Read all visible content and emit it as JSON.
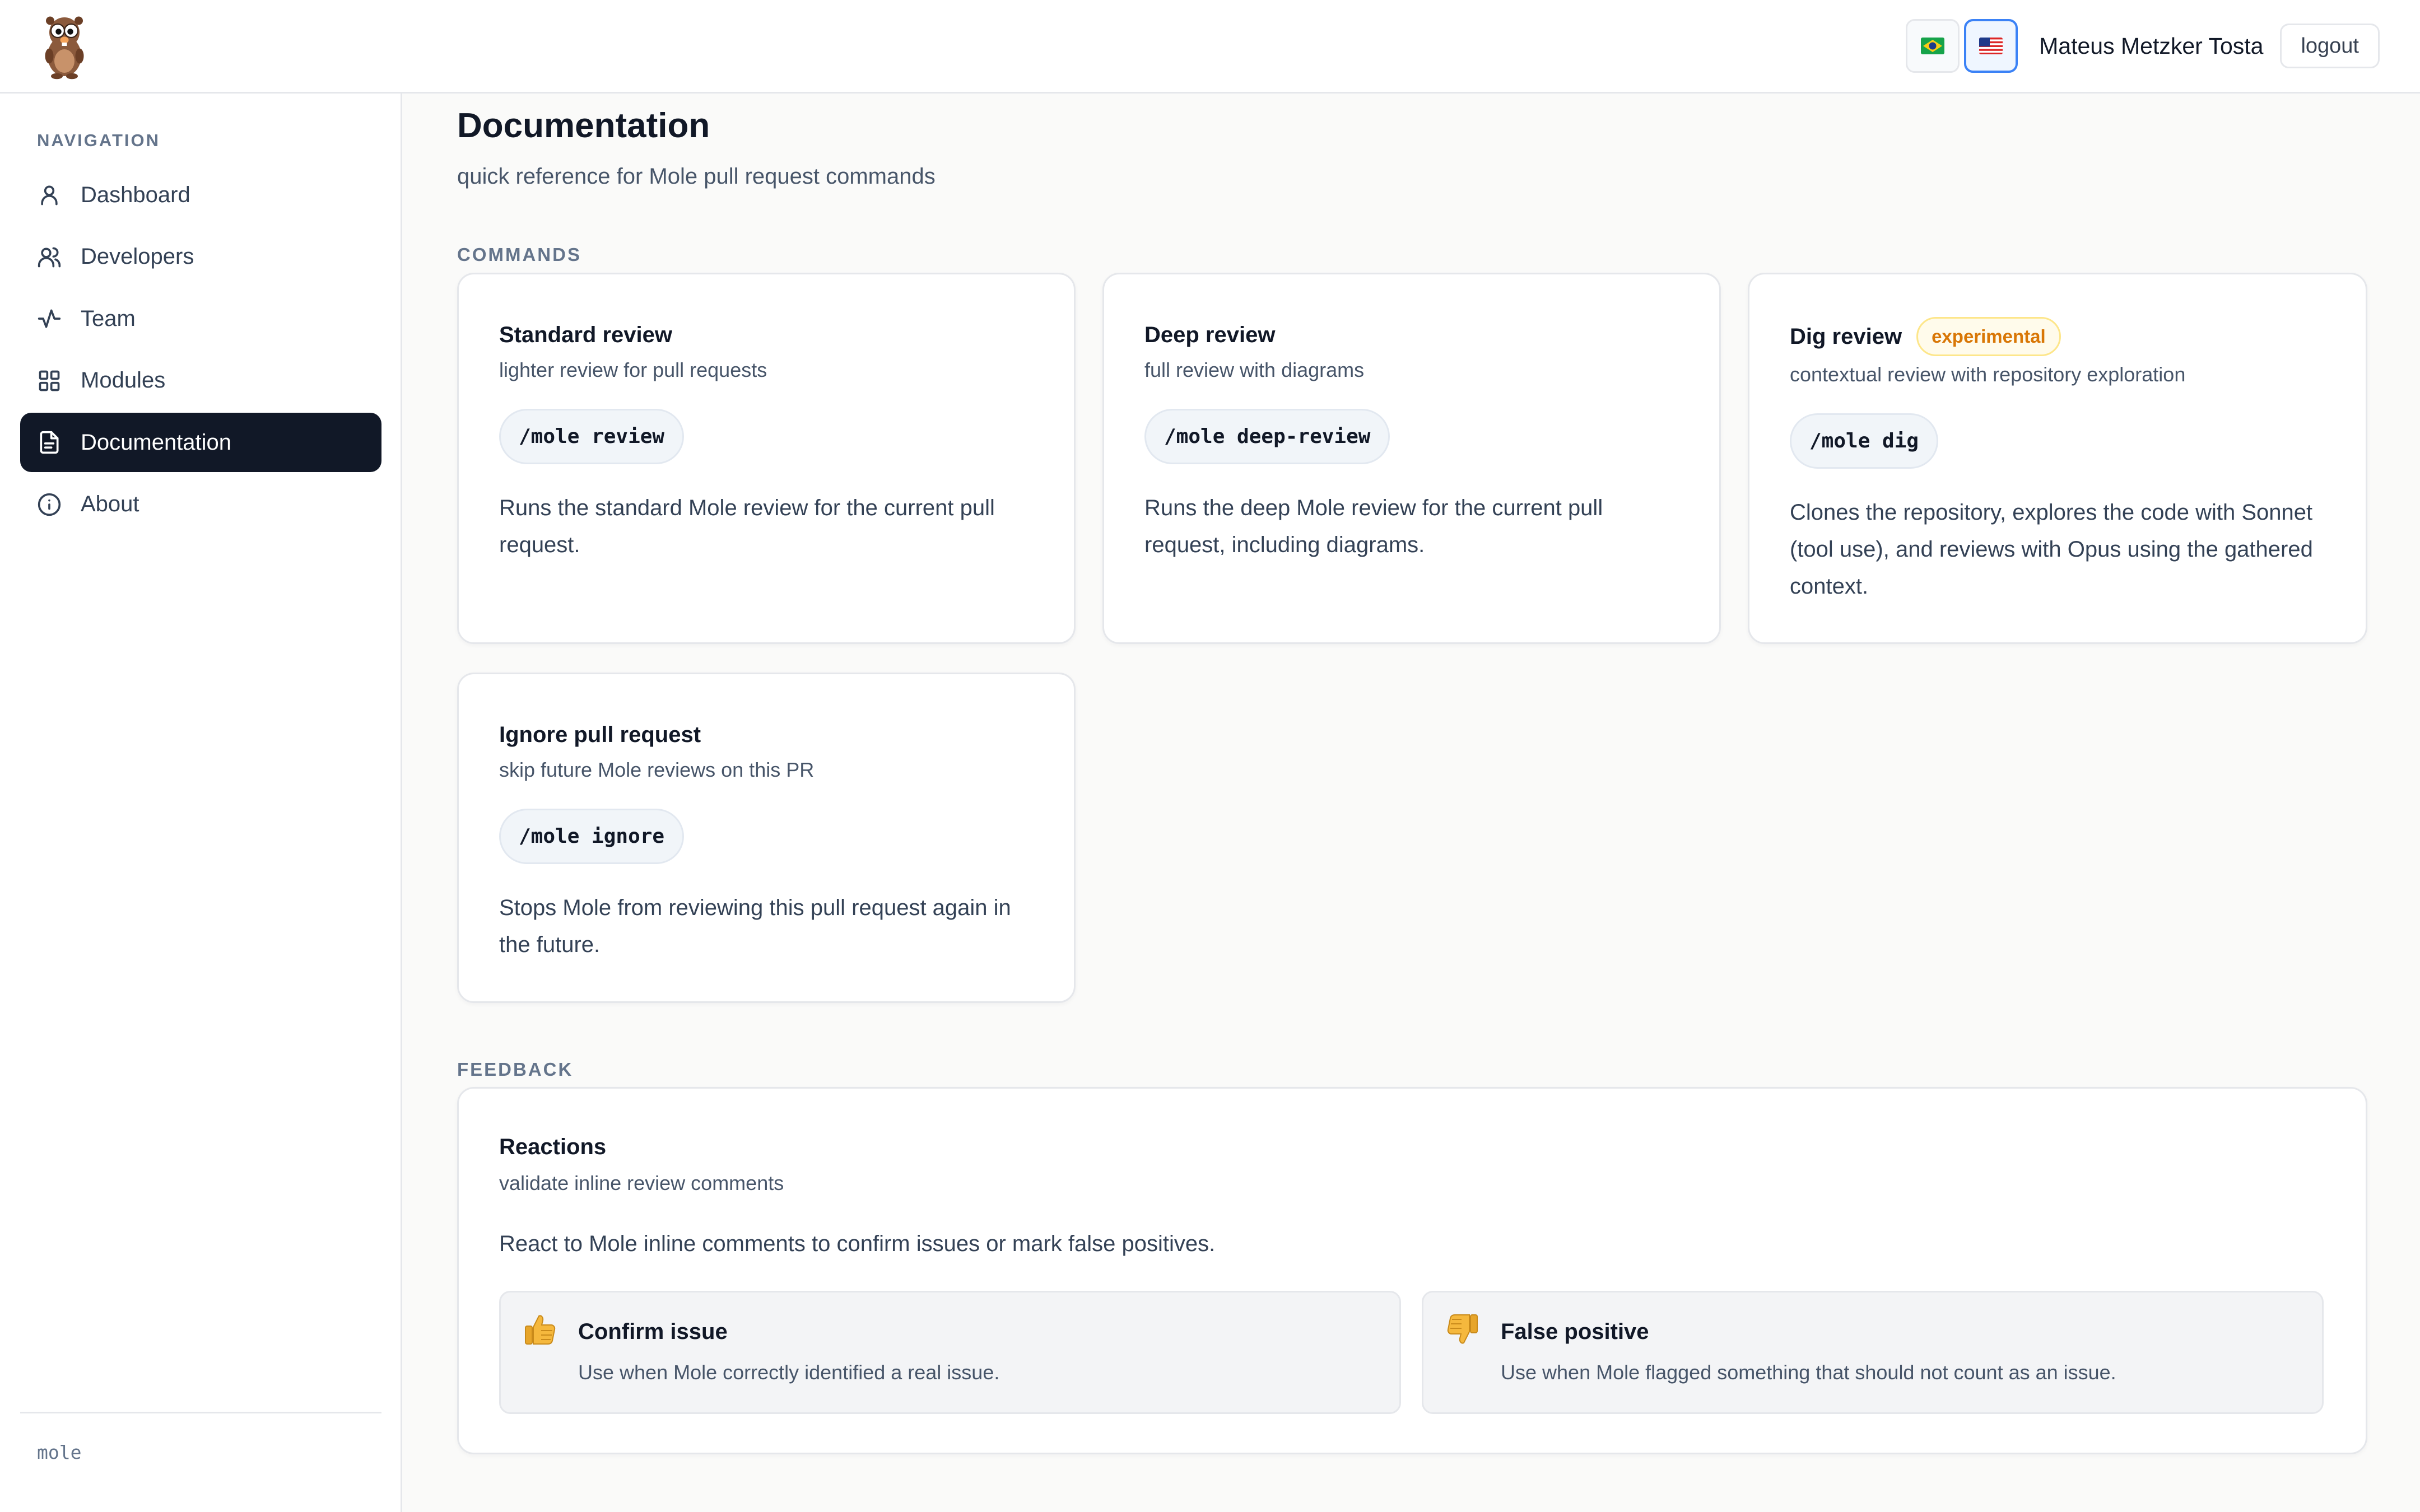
{
  "header": {
    "logo_name": "mole-logo",
    "flags": [
      {
        "name": "brazil-flag",
        "active": false
      },
      {
        "name": "usa-flag",
        "active": true
      }
    ],
    "user_name": "Mateus Metzker Tosta",
    "logout_label": "logout"
  },
  "sidebar": {
    "heading": "NAVIGATION",
    "items": [
      {
        "label": "Dashboard",
        "icon": "user-icon",
        "active": false
      },
      {
        "label": "Developers",
        "icon": "users-icon",
        "active": false
      },
      {
        "label": "Team",
        "icon": "activity-icon",
        "active": false
      },
      {
        "label": "Modules",
        "icon": "grid-icon",
        "active": false
      },
      {
        "label": "Documentation",
        "icon": "document-icon",
        "active": true
      },
      {
        "label": "About",
        "icon": "info-icon",
        "active": false
      }
    ],
    "footer": "mole"
  },
  "main": {
    "title": "Documentation",
    "subtitle": "quick reference for Mole pull request commands",
    "commands_label": "COMMANDS",
    "commands": [
      {
        "title": "Standard review",
        "subtitle": "lighter review for pull requests",
        "command": "/mole review",
        "description": "Runs the standard Mole review for the current pull request."
      },
      {
        "title": "Deep review",
        "subtitle": "full review with diagrams",
        "command": "/mole deep-review",
        "description": "Runs the deep Mole review for the current pull request, including diagrams."
      },
      {
        "title": "Dig review",
        "badge": "experimental",
        "subtitle": "contextual review with repository exploration",
        "command": "/mole dig",
        "description": "Clones the repository, explores the code with Sonnet (tool use), and reviews with Opus using the gathered context."
      },
      {
        "title": "Ignore pull request",
        "subtitle": "skip future Mole reviews on this PR",
        "command": "/mole ignore",
        "description": "Stops Mole from reviewing this pull request again in the future."
      }
    ],
    "feedback_label": "FEEDBACK",
    "feedback": {
      "title": "Reactions",
      "subtitle": "validate inline review comments",
      "description": "React to Mole inline comments to confirm issues or mark false positives.",
      "reactions": [
        {
          "icon": "thumbs-up-icon",
          "title": "Confirm issue",
          "description": "Use when Mole correctly identified a real issue."
        },
        {
          "icon": "thumbs-down-icon",
          "title": "False positive",
          "description": "Use when Mole flagged something that should not count as an issue."
        }
      ]
    }
  },
  "colors": {
    "accent": "#111827",
    "badge_text": "#d97706",
    "badge_bg": "#fffbeb",
    "flag_active_border": "#3b82f6"
  }
}
